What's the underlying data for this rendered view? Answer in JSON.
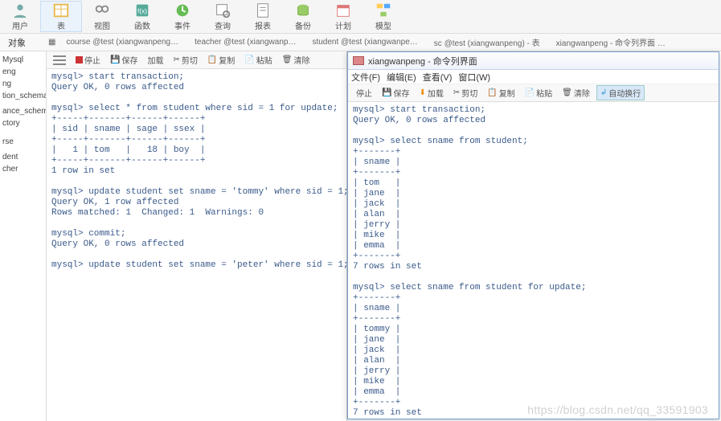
{
  "toolbar": {
    "items": [
      "用户",
      "表",
      "视图",
      "函数",
      "事件",
      "查询",
      "报表",
      "备份",
      "计划",
      "模型"
    ]
  },
  "objlabel": "对象",
  "tabs": [
    "course @test (xiangwanpeng…",
    "teacher @test (xiangwanp…",
    "student @test (xiangwanpe…",
    "sc @test (xiangwanpeng) - 表",
    "xiangwanpeng - 命令列界面 …"
  ],
  "sidebar": {
    "items": [
      "Mysql",
      "eng",
      "ng",
      "tion_schema",
      "",
      "ance_schema",
      "ctory",
      "",
      "",
      "rse",
      "",
      "dent",
      "cher"
    ]
  },
  "paneToolbar": {
    "stop": "停止",
    "save": "保存",
    "load": "加载",
    "cut": "剪切",
    "copy": "复制",
    "paste": "粘贴",
    "clear": "清除"
  },
  "leftConsole": "mysql> start transaction;\nQuery OK, 0 rows affected\n\nmysql> select * from student where sid = 1 for update;\n+-----+-------+------+------+\n| sid | sname | sage | ssex |\n+-----+-------+------+------+\n|   1 | tom   |   18 | boy  |\n+-----+-------+------+------+\n1 row in set\n\nmysql> update student set sname = 'tommy' where sid = 1;\nQuery OK, 1 row affected\nRows matched: 1  Changed: 1  Warnings: 0\n\nmysql> commit;\nQuery OK, 0 rows affected\n\nmysql> update student set sname = 'peter' where sid = 1;",
  "rightWindow": {
    "title": "xiangwanpeng - 命令列界面",
    "menus": [
      "文件(F)",
      "编辑(E)",
      "查看(V)",
      "窗口(W)"
    ],
    "toolbar": {
      "stop": "停止",
      "save": "保存",
      "load": "加载",
      "cut": "剪切",
      "copy": "复制",
      "paste": "粘贴",
      "clear": "清除",
      "wrap": "自动换行"
    },
    "console": "mysql> start transaction;\nQuery OK, 0 rows affected\n\nmysql> select sname from student;\n+-------+\n| sname |\n+-------+\n| tom   |\n| jane  |\n| jack  |\n| alan  |\n| jerry |\n| mike  |\n| emma  |\n+-------+\n7 rows in set\n\nmysql> select sname from student for update;\n+-------+\n| sname |\n+-------+\n| tommy |\n| jane  |\n| jack  |\n| alan  |\n| jerry |\n| mike  |\n| emma  |\n+-------+\n7 rows in set\n\nmysql> "
  },
  "watermark": "https://blog.csdn.net/qq_33591903",
  "colors": {
    "accent": "#4a7abf",
    "stop": "#c33"
  }
}
